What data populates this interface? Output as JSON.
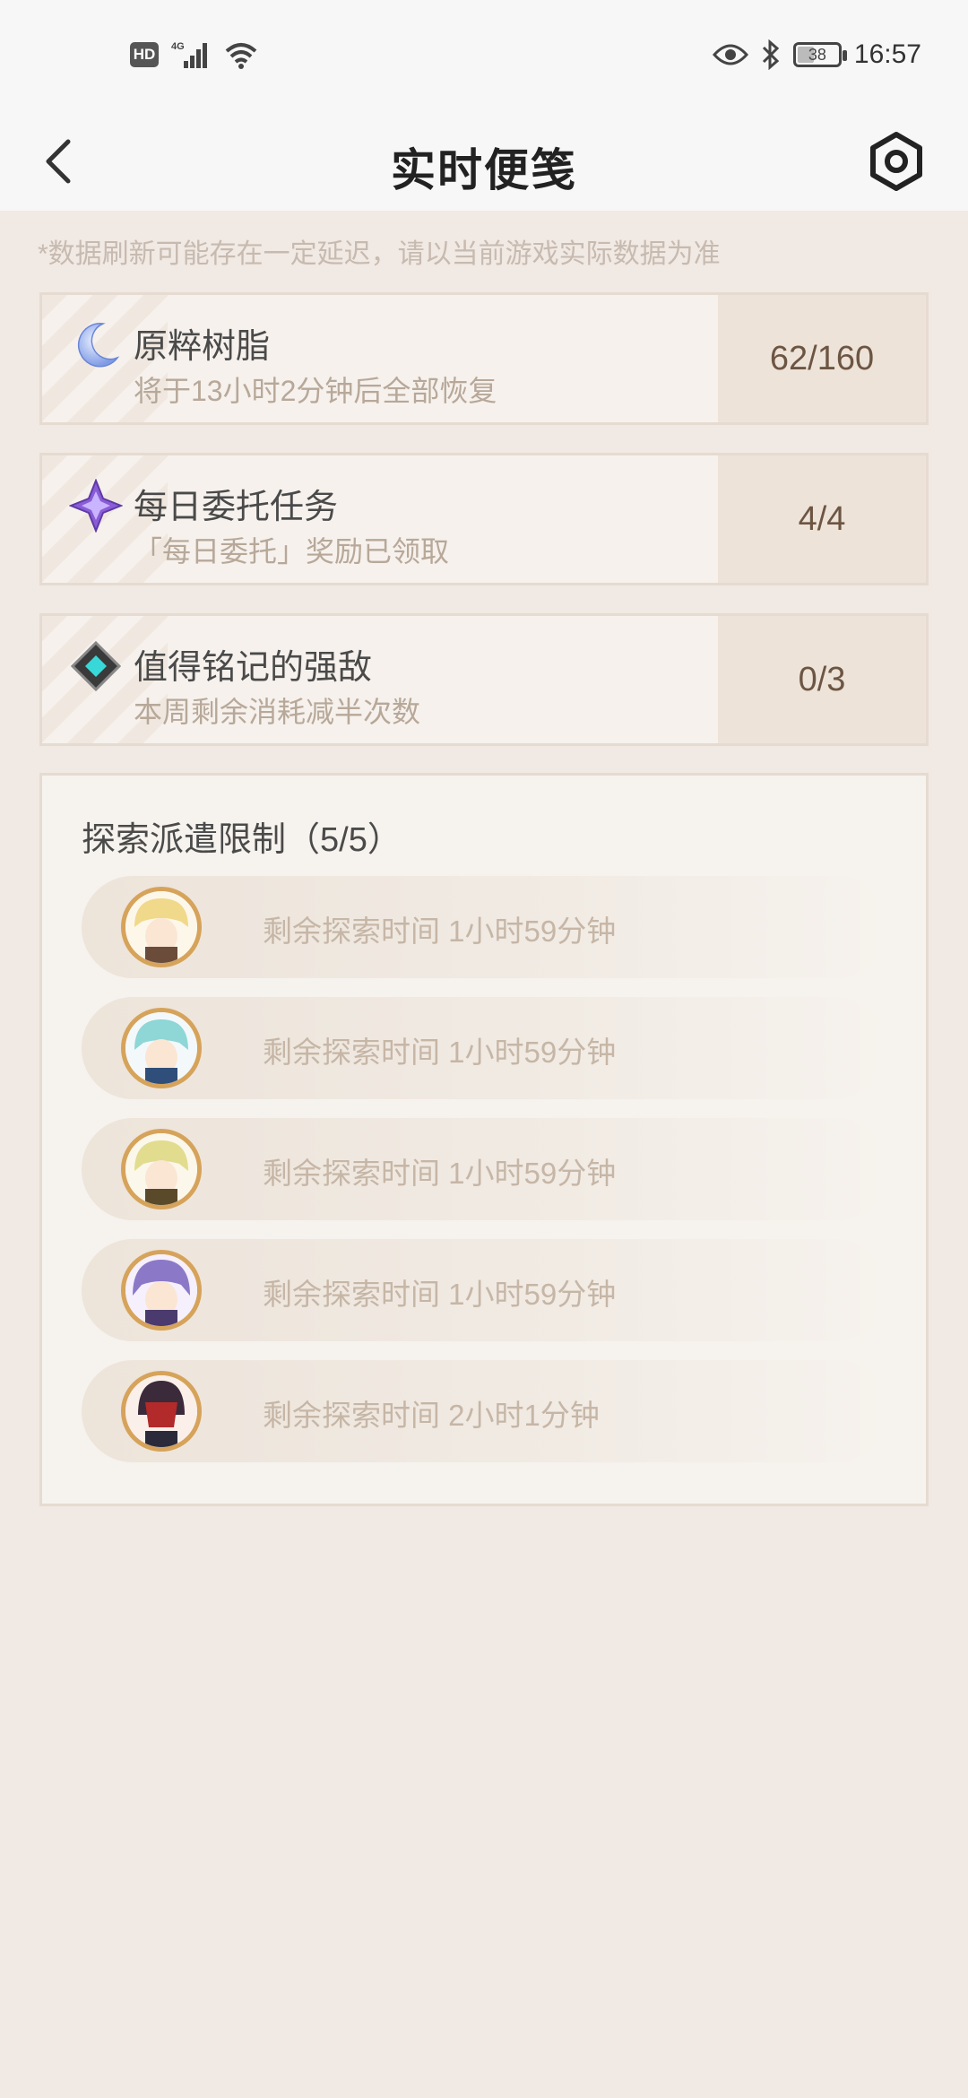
{
  "status_bar": {
    "network_type": "4G",
    "hd_label": "HD",
    "battery": "38",
    "time": "16:57"
  },
  "header": {
    "title": "实时便笺"
  },
  "notice": "*数据刷新可能存在一定延迟，请以当前游戏实际数据为准",
  "cards": [
    {
      "title": "原粹树脂",
      "subtitle": "将于13小时2分钟后全部恢复",
      "value": "62/160",
      "icon": "moon-icon"
    },
    {
      "title": "每日委托任务",
      "subtitle": "「每日委托」奖励已领取",
      "value": "4/4",
      "icon": "commission-star-icon"
    },
    {
      "title": "值得铭记的强敌",
      "subtitle": "本周剩余消耗减半次数",
      "value": "0/3",
      "icon": "boss-diamond-icon"
    }
  ],
  "expedition": {
    "title": "探索派遣限制（5/5）",
    "items": [
      {
        "text": "剩余探索时间 1小时59分钟"
      },
      {
        "text": "剩余探索时间 1小时59分钟"
      },
      {
        "text": "剩余探索时间 1小时59分钟"
      },
      {
        "text": "剩余探索时间 1小时59分钟"
      },
      {
        "text": "剩余探索时间 2小时1分钟"
      }
    ]
  },
  "colors": {
    "background": "#f1e9e3",
    "accent_brown": "#6d5543",
    "avatar_ring": "#d6a35b"
  }
}
